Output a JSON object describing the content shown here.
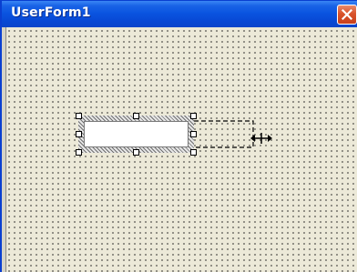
{
  "window": {
    "title": "UserForm1"
  },
  "icons": {
    "close": "close-icon",
    "resize_cursor": "horizontal-resize-cursor-icon"
  },
  "colors": {
    "titlebar": "#0a54e0",
    "form_background": "#ece9d8",
    "close_button": "#d9532b"
  }
}
